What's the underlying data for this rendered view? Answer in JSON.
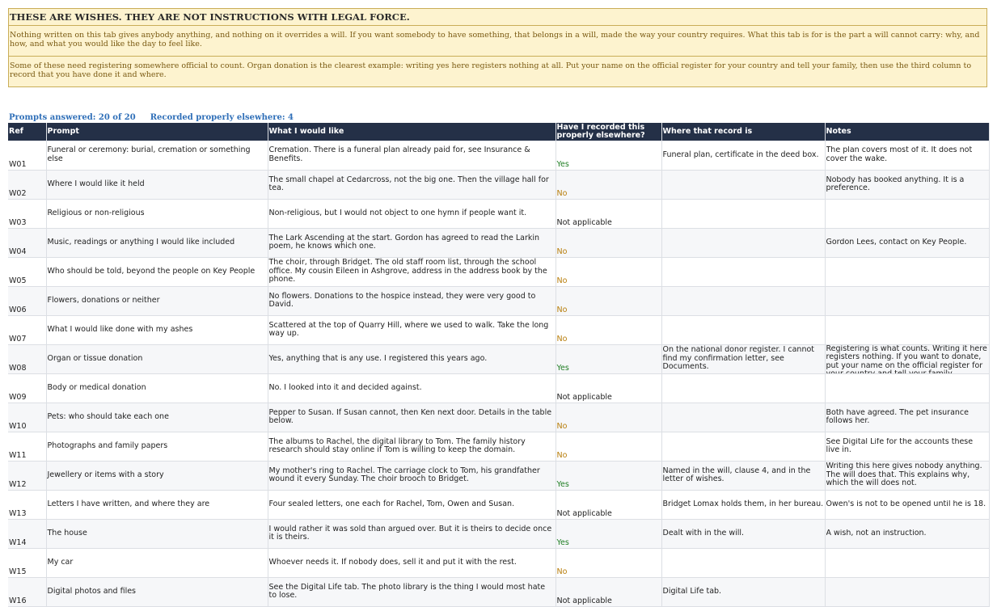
{
  "banner": {
    "title": "THESE ARE WISHES. THEY ARE NOT INSTRUCTIONS WITH LEGAL FORCE.",
    "para1": "Nothing written on this tab gives anybody anything, and nothing on it overrides a will. If you want somebody to have something, that belongs in a will, made the way your country requires. What this tab is for is the part a will cannot carry: why, and how, and what you would like the day to feel like.",
    "para2": "Some of these need registering somewhere official to count. Organ donation is the clearest example: writing yes here registers nothing at all. Put your name on the official register for your country and tell your family, then use the third column to record that you have done it and where."
  },
  "summary": {
    "answered": "Prompts answered: 20 of 20",
    "recorded": "Recorded properly elsewhere: 4"
  },
  "columns": [
    "Ref",
    "Prompt",
    "What I would like",
    "Have I recorded this properly elsewhere?",
    "Where that record is",
    "Notes"
  ],
  "rows": [
    {
      "ref": "W01",
      "prompt": "Funeral or ceremony: burial, cremation or something else",
      "like": "Cremation. There is a funeral plan already paid for, see Insurance & Benefits.",
      "recorded": "Yes",
      "where": "Funeral plan, certificate in the deed box.",
      "notes": "The plan covers most of it. It does not cover the wake."
    },
    {
      "ref": "W02",
      "prompt": "Where I would like it held",
      "like": "The small chapel at Cedarcross, not the big one. Then the village hall for tea.",
      "recorded": "No",
      "where": "",
      "notes": "Nobody has booked anything. It is a preference."
    },
    {
      "ref": "W03",
      "prompt": "Religious or non-religious",
      "like": "Non-religious, but I would not object to one hymn if people want it.",
      "recorded": "Not applicable",
      "where": "",
      "notes": ""
    },
    {
      "ref": "W04",
      "prompt": "Music, readings or anything I would like included",
      "like": "The Lark Ascending at the start. Gordon has agreed to read the Larkin poem, he knows which one.",
      "recorded": "No",
      "where": "",
      "notes": "Gordon Lees, contact on Key People."
    },
    {
      "ref": "W05",
      "prompt": "Who should be told, beyond the people on Key People",
      "like": "The choir, through Bridget. The old staff room list, through the school office. My cousin Eileen in Ashgrove, address in the address book by the phone.",
      "recorded": "No",
      "where": "",
      "notes": ""
    },
    {
      "ref": "W06",
      "prompt": "Flowers, donations or neither",
      "like": "No flowers. Donations to the hospice instead, they were very good to David.",
      "recorded": "No",
      "where": "",
      "notes": ""
    },
    {
      "ref": "W07",
      "prompt": "What I would like done with my ashes",
      "like": "Scattered at the top of Quarry Hill, where we used to walk. Take the long way up.",
      "recorded": "No",
      "where": "",
      "notes": ""
    },
    {
      "ref": "W08",
      "prompt": "Organ or tissue donation",
      "like": "Yes, anything that is any use. I registered this years ago.",
      "recorded": "Yes",
      "where": "On the national donor register. I cannot find my confirmation letter, see Documents.",
      "notes": "Registering is what counts. Writing it here registers nothing. If you want to donate, put your name on the official register for your country and tell your family."
    },
    {
      "ref": "W09",
      "prompt": "Body or medical donation",
      "like": "No. I looked into it and decided against.",
      "recorded": "Not applicable",
      "where": "",
      "notes": ""
    },
    {
      "ref": "W10",
      "prompt": "Pets: who should take each one",
      "like": "Pepper to Susan. If Susan cannot, then Ken next door. Details in the table below.",
      "recorded": "No",
      "where": "",
      "notes": "Both have agreed. The pet insurance follows her."
    },
    {
      "ref": "W11",
      "prompt": "Photographs and family papers",
      "like": "The albums to Rachel, the digital library to Tom. The family history research should stay online if Tom is willing to keep the domain.",
      "recorded": "No",
      "where": "",
      "notes": "See Digital Life for the accounts these live in."
    },
    {
      "ref": "W12",
      "prompt": "Jewellery or items with a story",
      "like": "My mother's ring to Rachel. The carriage clock to Tom, his grandfather wound it every Sunday. The choir brooch to Bridget.",
      "recorded": "Yes",
      "where": "Named in the will, clause 4, and in the letter of wishes.",
      "notes": "Writing this here gives nobody anything. The will does that. This explains why, which the will does not."
    },
    {
      "ref": "W13",
      "prompt": "Letters I have written, and where they are",
      "like": "Four sealed letters, one each for Rachel, Tom, Owen and Susan.",
      "recorded": "Not applicable",
      "where": "Bridget Lomax holds them, in her bureau.",
      "notes": "Owen's is not to be opened until he is 18."
    },
    {
      "ref": "W14",
      "prompt": "The house",
      "like": "I would rather it was sold than argued over. But it is theirs to decide once it is theirs.",
      "recorded": "Yes",
      "where": "Dealt with in the will.",
      "notes": "A wish, not an instruction."
    },
    {
      "ref": "W15",
      "prompt": "My car",
      "like": "Whoever needs it. If nobody does, sell it and put it with the rest.",
      "recorded": "No",
      "where": "",
      "notes": ""
    },
    {
      "ref": "W16",
      "prompt": "Digital photos and files",
      "like": "See the Digital Life tab. The photo library is the thing I would most hate to lose.",
      "recorded": "Not applicable",
      "where": "Digital Life tab.",
      "notes": ""
    }
  ]
}
